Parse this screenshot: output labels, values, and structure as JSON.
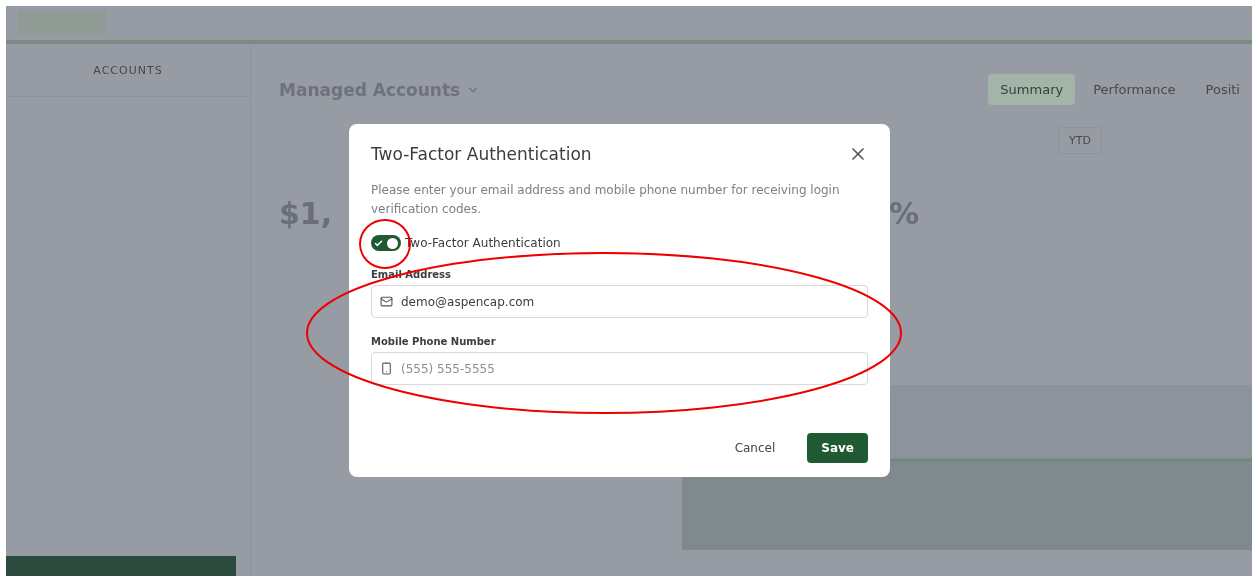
{
  "app": {
    "sidebar": {
      "header": "ACCOUNTS"
    },
    "page_title": "Managed Accounts",
    "tabs": [
      {
        "label": "Summary",
        "selected": true
      },
      {
        "label": "Performance",
        "selected": false
      },
      {
        "label": "Positi",
        "selected": false
      }
    ],
    "period": "YTD",
    "stat_value": "$1,",
    "stat_change": "%"
  },
  "dialog": {
    "title": "Two-Factor Authentication",
    "description": "Please enter your email address and mobile phone number for receiving login verification codes.",
    "toggle": {
      "label": "Two-Factor Authentication",
      "on": true
    },
    "fields": [
      {
        "kind": "email",
        "label": "Email Address",
        "value": "demo@aspencap.com"
      },
      {
        "kind": "phone",
        "label": "Mobile Phone Number",
        "placeholder": "(555) 555-5555"
      }
    ],
    "buttons": [
      {
        "kind": "secondary",
        "label": "Cancel"
      },
      {
        "kind": "primary",
        "label": "Save"
      }
    ]
  }
}
